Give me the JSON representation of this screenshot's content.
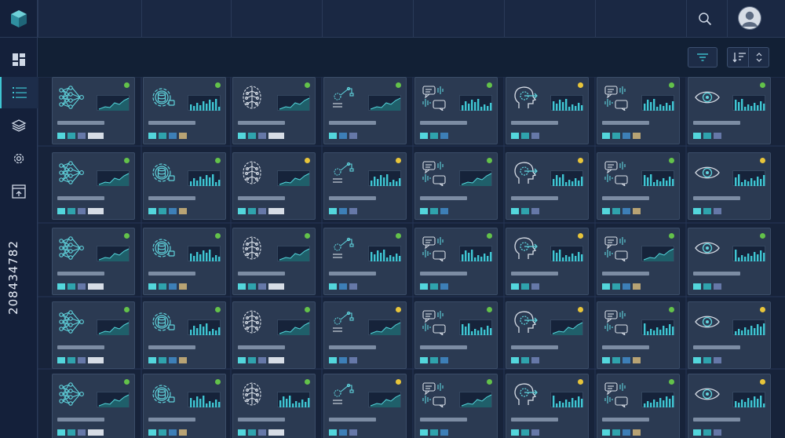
{
  "sidebar": {
    "vertical_id": "208434782",
    "items": [
      {
        "name": "dashboard",
        "icon": "dashboard-icon",
        "active": false
      },
      {
        "name": "list",
        "icon": "list-icon",
        "active": true
      },
      {
        "name": "layers",
        "icon": "layers-icon",
        "active": false
      },
      {
        "name": "settings",
        "icon": "gear-icon",
        "active": false
      },
      {
        "name": "export",
        "icon": "export-window-icon",
        "active": false
      }
    ]
  },
  "topbar": {
    "search_icon": "search-icon",
    "avatar_icon": "user-avatar-icon"
  },
  "toolbar": {
    "filter_icon": "filter-icon",
    "sort_icon": "sort-icon",
    "stepper_icon": "chevron-up-down-icon"
  },
  "colors": {
    "green": "#63c24a",
    "yellow": "#e8c53a",
    "cyan": "#53d6dc",
    "teal": "#2fa3ad",
    "blue": "#3d7fb7",
    "slate": "#6678a8",
    "tan": "#b8a374",
    "white": "#d7dde6"
  },
  "columns": [
    "neural-net-icon",
    "gear-database-icon",
    "brain-icon",
    "robot-arm-icon",
    "voice-chat-icon",
    "head-gear-icon",
    "voice-chat-icon",
    "eye-icon"
  ],
  "grid": [
    {
      "status": [
        "green",
        "green",
        "green",
        "green",
        "green",
        "yellow",
        "green",
        "green"
      ],
      "chart": [
        "line",
        "bars",
        "line",
        "line",
        "bars",
        "bars",
        "bars",
        "bars"
      ]
    },
    {
      "status": [
        "green",
        "green",
        "yellow",
        "yellow",
        "green",
        "yellow",
        "green",
        "yellow"
      ],
      "chart": [
        "line",
        "bars",
        "line",
        "bars",
        "line",
        "bars",
        "bars",
        "bars"
      ]
    },
    {
      "status": [
        "green",
        "green",
        "green",
        "green",
        "green",
        "yellow",
        "green",
        "green"
      ],
      "chart": [
        "line",
        "bars",
        "line",
        "bars",
        "bars",
        "bars",
        "line",
        "bars"
      ]
    },
    {
      "status": [
        "green",
        "green",
        "green",
        "yellow",
        "green",
        "yellow",
        "green",
        "yellow"
      ],
      "chart": [
        "line",
        "bars",
        "line",
        "line",
        "bars",
        "line",
        "bars",
        "bars"
      ]
    },
    {
      "status": [
        "green",
        "green",
        "green",
        "yellow",
        "green",
        "yellow",
        "green",
        "yellow"
      ],
      "chart": [
        "line",
        "bars",
        "bars",
        "line",
        "line",
        "bars",
        "bars",
        "bars"
      ]
    }
  ],
  "chip_sets": [
    [
      "cyan",
      "teal",
      "slate",
      "white-wide"
    ],
    [
      "cyan",
      "teal",
      "blue",
      "tan"
    ],
    [
      "cyan",
      "teal",
      "slate",
      "white-wide"
    ],
    [
      "cyan",
      "blue",
      "slate"
    ],
    [
      "cyan",
      "teal",
      "blue"
    ],
    [
      "cyan",
      "teal",
      "slate"
    ],
    [
      "cyan",
      "teal",
      "blue",
      "tan"
    ],
    [
      "cyan",
      "teal",
      "slate"
    ]
  ]
}
